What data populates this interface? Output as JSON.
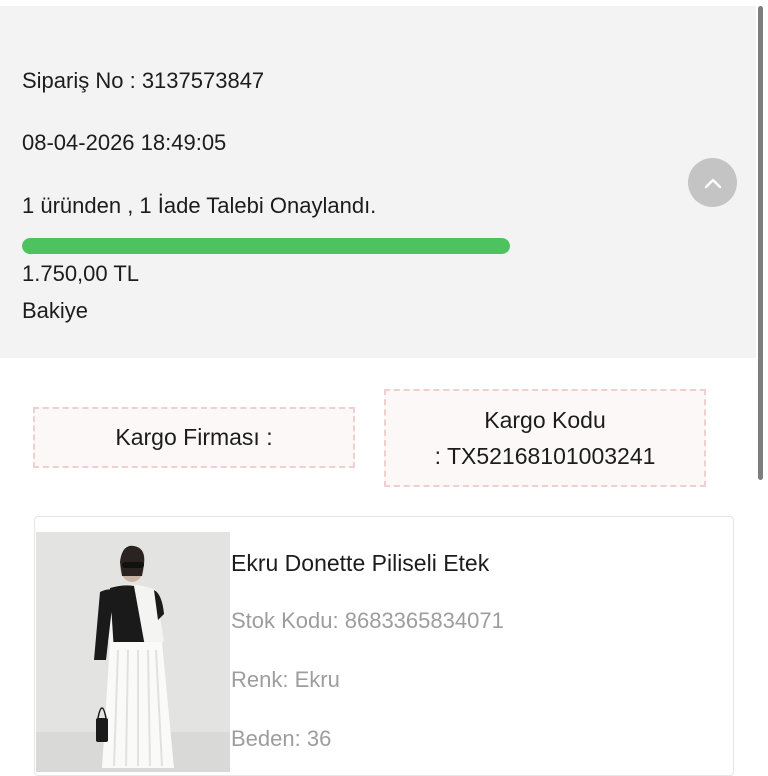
{
  "order": {
    "order_no": "Sipariş No : 3137573847",
    "date": "08-04-2026 18:49:05",
    "return_status": "1 üründen , 1 İade Talebi Onaylandı.",
    "progress": 1.0,
    "amount": "1.750,00 TL",
    "amount_label": "Bakiye"
  },
  "shipping": {
    "carrier_label": "Kargo Firması :",
    "tracking_label": "Kargo Kodu",
    "tracking_value": ": TX52168101003241"
  },
  "product": {
    "name": "Ekru Donette Piliseli Etek",
    "sku": "Stok Kodu: 8683365834071",
    "color": "Renk: Ekru",
    "size": "Beden: 36"
  },
  "icons": {
    "scroll_top": "chevron-up-icon"
  },
  "colors": {
    "progress": "#4cc35e",
    "summary_bg": "#f3f3f3",
    "dashed_border": "#f0cfcf",
    "secondary_text": "#9d9d9d"
  }
}
